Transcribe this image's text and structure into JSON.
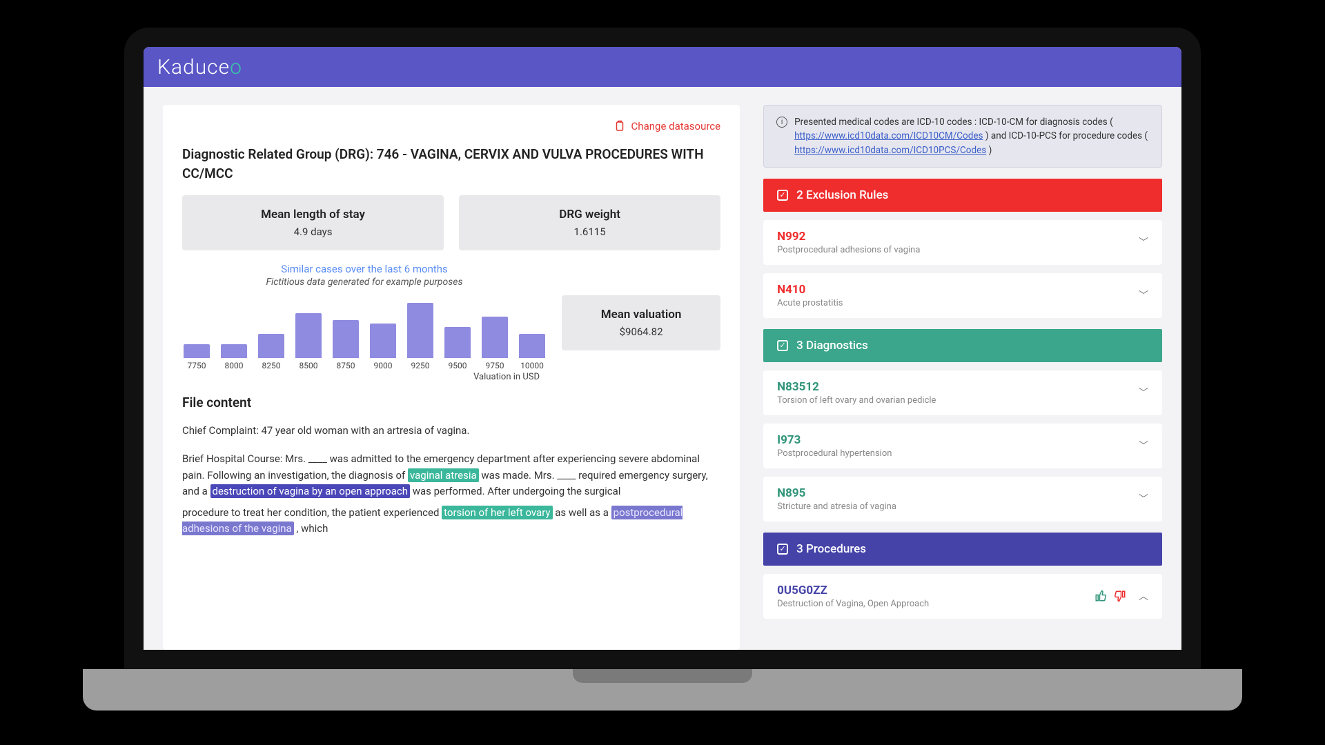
{
  "brand": {
    "prefix": "Kaduce",
    "accent": "o"
  },
  "actions": {
    "change_datasource": "Change datasource"
  },
  "drg_title": "Diagnostic Related Group (DRG): 746 - VAGINA, CERVIX AND VULVA PROCEDURES WITH CC/MCC",
  "stats": {
    "los_label": "Mean length of stay",
    "los_value": "4.9 days",
    "weight_label": "DRG weight",
    "weight_value": "1.6115",
    "valuation_label": "Mean valuation",
    "valuation_value": "$9064.82"
  },
  "chart_data": {
    "type": "bar",
    "title": "Similar cases over the last 6 months",
    "subtitle": "Fictitious data generated for example purposes",
    "xlabel": "Valuation in USD",
    "ylabel": "",
    "categories": [
      "7750",
      "8000",
      "8250",
      "8500",
      "8750",
      "9000",
      "9250",
      "9500",
      "9750",
      "10000"
    ],
    "values": [
      20,
      20,
      35,
      65,
      55,
      50,
      80,
      45,
      60,
      35
    ],
    "ylim": [
      0,
      100
    ]
  },
  "file": {
    "heading": "File content",
    "complaint": "Chief Complaint: 47 year old woman with an artresia of vagina.",
    "course_pre": "Brief Hospital Course: Mrs. ____ was admitted to the emergency department after experiencing severe abdominal pain. Following an investigation, the diagnosis of ",
    "hl1": "vaginal atresia",
    "course_p1": " was made. Mrs. ____ required emergency surgery, and a ",
    "hl2": "destruction of vagina by an open approach",
    "course_p2": " was performed. After undergoing the surgical",
    "course_p3_pre": "procedure to treat her condition, the patient experienced ",
    "hl3": "torsion of her left ovary",
    "course_p3_mid": " as well as a ",
    "hl4": "postprocedural adhesions of the vagina",
    "course_p3_post": ", which"
  },
  "info_notice": {
    "text_a": "Presented medical codes are ICD-10 codes : ICD-10-CM for diagnosis codes (",
    "link1": "https://www.icd10data.com/ICD10CM/Codes",
    "text_b": ") and ICD-10-PCS for procedure codes (",
    "link2": "https://www.icd10data.com/ICD10PCS/Codes",
    "text_c": ")"
  },
  "panels": {
    "exclusion": {
      "header": "2 Exclusion Rules",
      "items": [
        {
          "code": "N992",
          "desc": "Postprocedural adhesions of vagina"
        },
        {
          "code": "N410",
          "desc": "Acute prostatitis"
        }
      ]
    },
    "diagnostics": {
      "header": "3 Diagnostics",
      "items": [
        {
          "code": "N83512",
          "desc": "Torsion of left ovary and ovarian pedicle"
        },
        {
          "code": "I973",
          "desc": "Postprocedural hypertension"
        },
        {
          "code": "N895",
          "desc": "Stricture and atresia of vagina"
        }
      ]
    },
    "procedures": {
      "header": "3 Procedures",
      "items": [
        {
          "code": "0U5G0ZZ",
          "desc": "Destruction of Vagina, Open Approach"
        }
      ]
    }
  }
}
